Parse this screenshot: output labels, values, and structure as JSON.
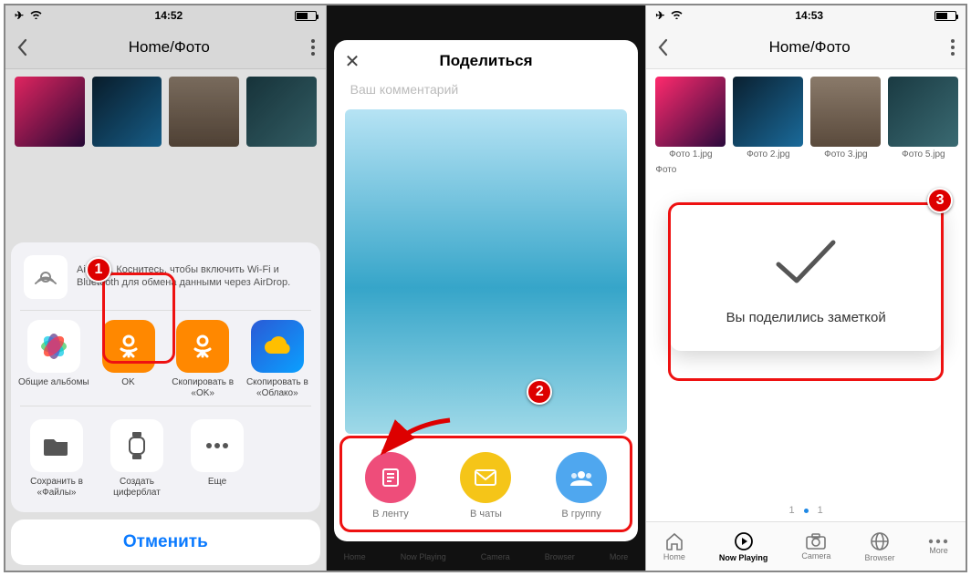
{
  "panel1": {
    "time": "14:52",
    "header": "Home/Фото",
    "airdrop_text": "AirDrop. Коснитесь, чтобы включить Wi-Fi и Bluetooth для обмена данными через AirDrop.",
    "apps": [
      {
        "label": "Общие альбомы"
      },
      {
        "label": "OK"
      },
      {
        "label": "Скопировать в «OK»"
      },
      {
        "label": "Скопировать в «Облако»"
      }
    ],
    "actions": [
      {
        "label": "Сохранить в «Файлы»"
      },
      {
        "label": "Создать циферблат"
      },
      {
        "label": "Еще"
      }
    ],
    "cancel": "Отменить",
    "badge": "1"
  },
  "panel2": {
    "title": "Поделиться",
    "comment_placeholder": "Ваш комментарий",
    "buttons": [
      {
        "label": "В ленту",
        "color": "#ee4d7a"
      },
      {
        "label": "В чаты",
        "color": "#f5c518"
      },
      {
        "label": "В группу",
        "color": "#4fa7ef"
      }
    ],
    "backtabs": [
      "Home",
      "Now Playing",
      "Camera",
      "Browser",
      "More"
    ],
    "badge": "2"
  },
  "panel3": {
    "time": "14:53",
    "header": "Home/Фото",
    "thumbs": [
      "Фото 1.jpg",
      "Фото 2.jpg",
      "Фото 3.jpg",
      "Фото 5.jpg"
    ],
    "partial_thumb": "Фото",
    "toast": "Вы поделились заметкой",
    "pager_left": "1",
    "pager_right": "1",
    "tabs": [
      "Home",
      "Now Playing",
      "Camera",
      "Browser",
      "More"
    ],
    "badge": "3"
  },
  "thumb_colors": [
    "#c41e6b",
    "#0e4a6a",
    "#7a675c",
    "#2a4a52"
  ]
}
